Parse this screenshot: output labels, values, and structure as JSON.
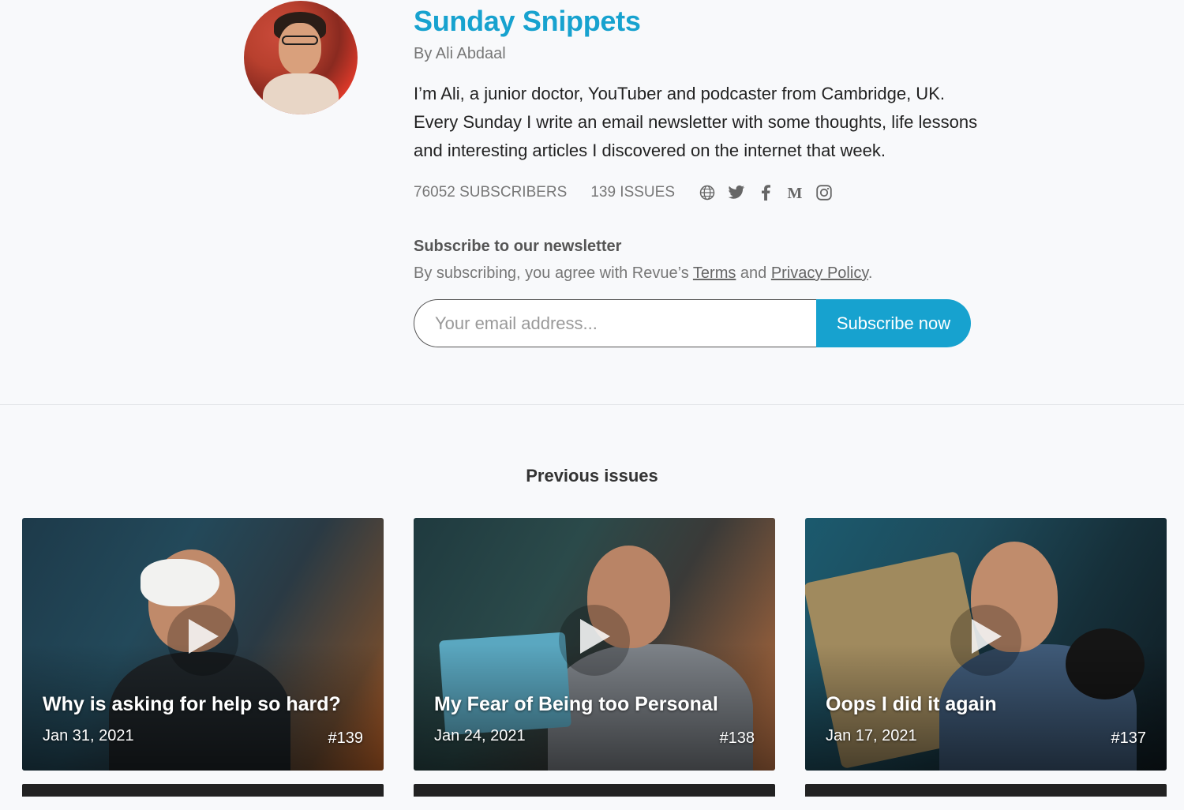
{
  "profile": {
    "title": "Sunday Snippets",
    "byline": "By Ali Abdaal",
    "description": "I’m Ali, a junior doctor, YouTuber and podcaster from Cambridge, UK. Every Sunday I write an email newsletter with some thoughts, life lessons and interesting articles I discovered on the internet that week.",
    "subscribers": "76052 SUBSCRIBERS",
    "issues": "139 ISSUES",
    "socials": [
      "globe-icon",
      "twitter-icon",
      "facebook-icon",
      "medium-icon",
      "instagram-icon"
    ]
  },
  "subscribe": {
    "heading": "Subscribe to our newsletter",
    "note_prefix": "By subscribing, you agree with Revue’s ",
    "terms_label": "Terms",
    "note_and": " and ",
    "privacy_label": "Privacy Policy",
    "note_suffix": ".",
    "email_placeholder": "Your email address...",
    "button_label": "Subscribe now"
  },
  "previous": {
    "heading": "Previous issues",
    "cards": [
      {
        "title": "Why is asking for help so hard?",
        "date": "Jan 31, 2021",
        "number": "#139"
      },
      {
        "title": "My Fear of Being too Personal",
        "date": "Jan 24, 2021",
        "number": "#138"
      },
      {
        "title": "Oops I did it again",
        "date": "Jan 17, 2021",
        "number": "#137"
      }
    ]
  },
  "colors": {
    "accent": "#17a2cf",
    "background": "#f8f9fb"
  }
}
